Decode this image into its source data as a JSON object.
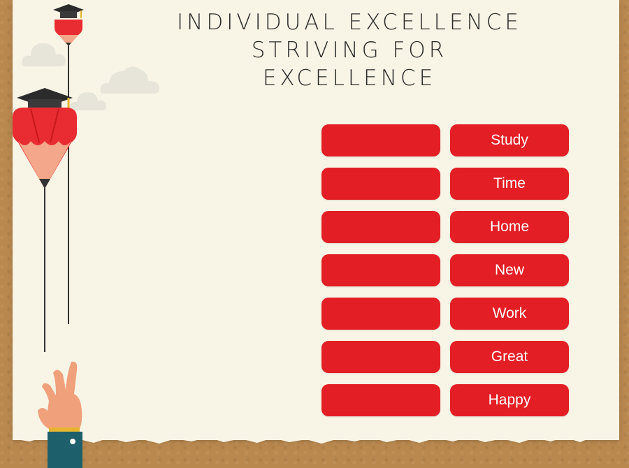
{
  "title": {
    "line1": "INDIVIDUAL EXCELLENCE",
    "line2": "STRIVING FOR EXCELLENCE"
  },
  "blank_slots": [
    "",
    "",
    "",
    "",
    "",
    "",
    ""
  ],
  "words": [
    "Study",
    "Time",
    "Home",
    "New",
    "Work",
    "Great",
    "Happy"
  ],
  "colors": {
    "button": "#e31e24",
    "paper": "#f8f5e6",
    "board": "#b9884e",
    "title_text": "#2a2a2a"
  },
  "icons": [
    "cloud-icon",
    "balloon-pencil-icon",
    "graduation-cap-icon",
    "hand-icon"
  ]
}
